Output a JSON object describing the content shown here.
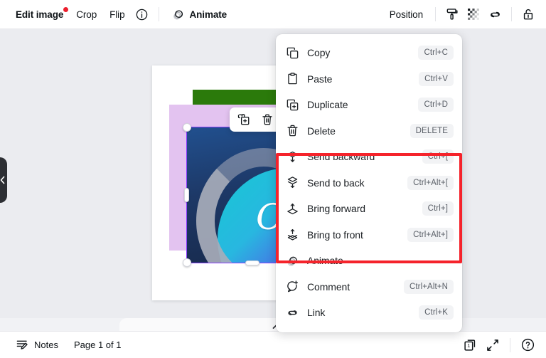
{
  "toolbar": {
    "edit_image_label": "Edit image",
    "has_notification_dot": true,
    "crop_label": "Crop",
    "flip_label": "Flip",
    "info_icon": "info-circle-icon",
    "animate_label": "Animate",
    "animate_icon": "animate-icon",
    "position_label": "Position",
    "icons": [
      {
        "name": "paint-roller-icon"
      },
      {
        "name": "transparency-icon"
      },
      {
        "name": "link-icon"
      },
      {
        "name": "unlock-icon"
      }
    ]
  },
  "canvas": {
    "artwork": {
      "word_text": "Ca",
      "green_block_color": "#2b7a0b",
      "lilac_block_color": "#e3c3f0",
      "photo_bg_color": "#1d3a68",
      "gradient_from": "#17c8d4",
      "gradient_to": "#6b22e0",
      "selection_color": "#8b3dff"
    },
    "mini_toolbar": [
      {
        "name": "duplicate-icon"
      },
      {
        "name": "delete-icon"
      }
    ],
    "rotate_handle_icon": "rotate-icon",
    "left_panel_toggle_icon": "chevron-left-icon",
    "scroll_up_icon": "chevron-up-icon"
  },
  "context_menu": {
    "highlight_color": "#f5232b",
    "groups": [
      {
        "items": [
          {
            "icon": "copy-icon",
            "label": "Copy",
            "shortcut": "Ctrl+C"
          },
          {
            "icon": "paste-icon",
            "label": "Paste",
            "shortcut": "Ctrl+V"
          },
          {
            "icon": "duplicate-icon",
            "label": "Duplicate",
            "shortcut": "Ctrl+D"
          },
          {
            "icon": "trash-icon",
            "label": "Delete",
            "shortcut": "DELETE"
          }
        ]
      },
      {
        "highlighted": true,
        "items": [
          {
            "icon": "send-backward-icon",
            "label": "Send backward",
            "shortcut": "Ctrl+["
          },
          {
            "icon": "send-to-back-icon",
            "label": "Send to back",
            "shortcut": "Ctrl+Alt+["
          },
          {
            "icon": "bring-forward-icon",
            "label": "Bring forward",
            "shortcut": "Ctrl+]"
          },
          {
            "icon": "bring-to-front-icon",
            "label": "Bring to front",
            "shortcut": "Ctrl+Alt+]"
          }
        ]
      },
      {
        "items": [
          {
            "icon": "animate-icon",
            "label": "Animate",
            "shortcut": ""
          },
          {
            "icon": "comment-icon",
            "label": "Comment",
            "shortcut": "Ctrl+Alt+N"
          },
          {
            "icon": "link-icon",
            "label": "Link",
            "shortcut": "Ctrl+K"
          }
        ]
      }
    ]
  },
  "bottombar": {
    "notes_label": "Notes",
    "notes_icon": "notes-icon",
    "page_label": "Page 1 of 1",
    "page_count_value": "1",
    "page_count_icon": "pages-icon",
    "fullscreen_icon": "expand-icon",
    "help_icon": "help-circle-icon"
  }
}
